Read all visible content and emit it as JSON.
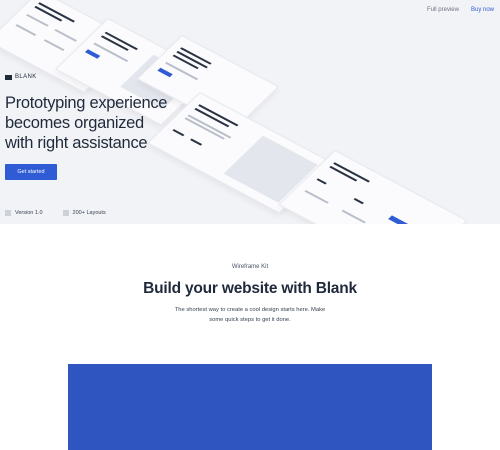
{
  "nav": {
    "full_preview": "Full preview",
    "buy_now": "Buy now"
  },
  "hero": {
    "brand": "BLANK",
    "headline_line1": "Prototyping experience",
    "headline_line2": "becomes organized",
    "headline_line3": "with right assistance",
    "cta_label": "Get started",
    "version": "Version 1.0",
    "layouts": "200+ Layouts"
  },
  "build": {
    "eyebrow": "Wireframe Kit",
    "title": "Build your website with Blank",
    "desc_line1": "The shortest way to create a cool design starts here. Make",
    "desc_line2": "some quick steps to get it done."
  },
  "colors": {
    "accent": "#2f5bd4",
    "hero_bg": "#f2f3f6",
    "text_dark": "#1f2a3a",
    "video_block": "#2f56c0"
  }
}
